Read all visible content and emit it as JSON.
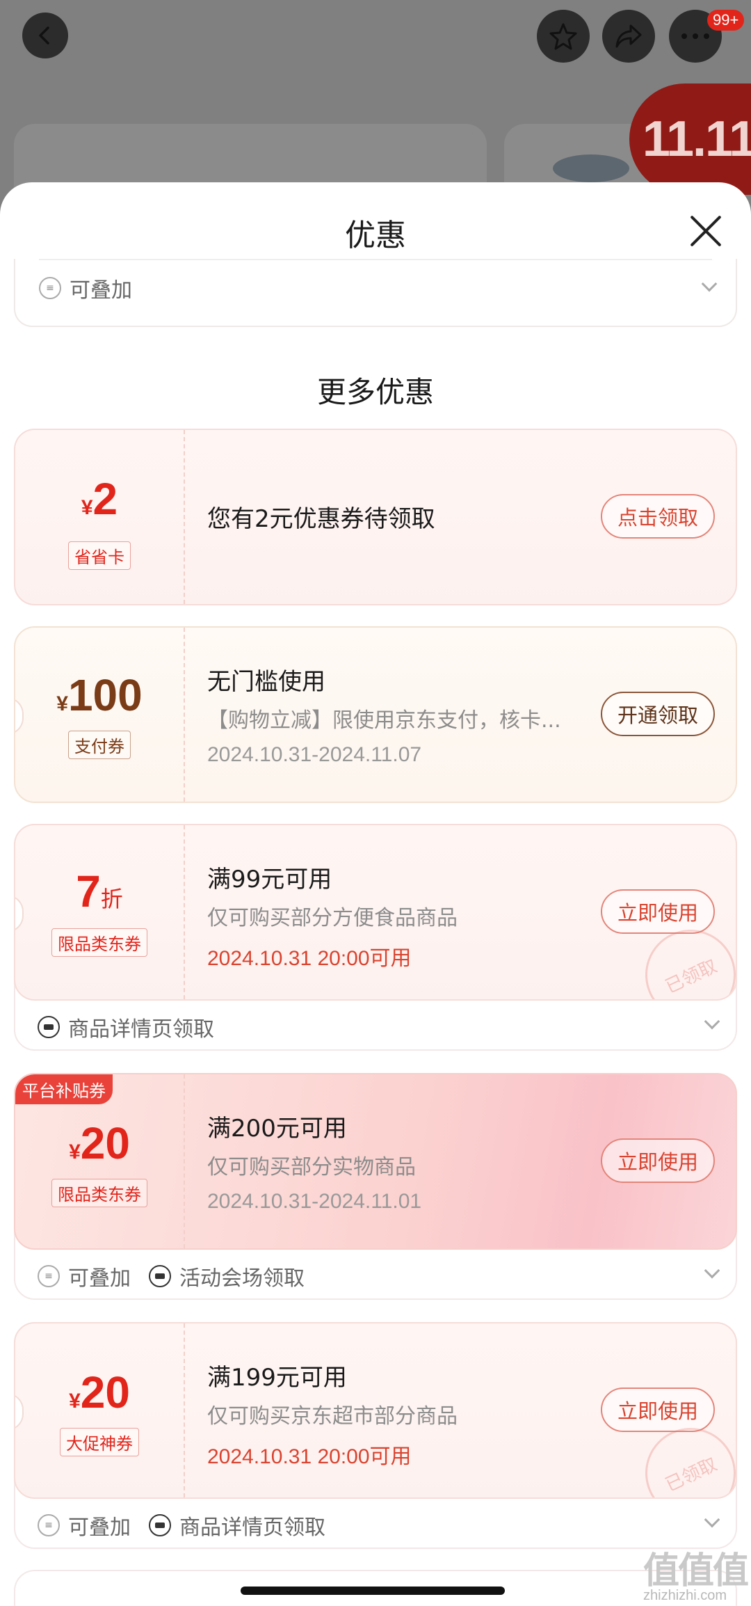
{
  "topbar": {
    "notification_badge": "99+",
    "promo_logo_text": "11.11",
    "icons": [
      "back-icon",
      "star-icon",
      "share-icon",
      "more-icon"
    ]
  },
  "sheet": {
    "title": "优惠",
    "prev_card_footer": "可叠加",
    "section_title": "更多优惠"
  },
  "coupons": [
    {
      "currency": "¥",
      "amount": "2",
      "tag": "省省卡",
      "title": "您有2元优惠券待领取",
      "button": "点击领取"
    },
    {
      "currency": "¥",
      "amount": "100",
      "tag": "支付券",
      "title": "无门槛使用",
      "desc": "【购物立减】限使用京东支付，核卡...",
      "date": "2024.10.31-2024.11.07",
      "button": "开通领取"
    },
    {
      "amount": "7",
      "unit": "折",
      "tag": "限品类东券",
      "title": "满99元可用",
      "desc": "仅可购买部分方便食品商品",
      "date": "2024.10.31 20:00可用",
      "button": "立即使用",
      "stamp": "已领取",
      "footer_source": "商品详情页领取"
    },
    {
      "ribbon": "平台补贴券",
      "currency": "¥",
      "amount": "20",
      "tag": "限品类东券",
      "title": "满200元可用",
      "desc": "仅可购买部分实物商品",
      "date": "2024.10.31-2024.11.01",
      "button": "立即使用",
      "footer_stack": "可叠加",
      "footer_source": "活动会场领取"
    },
    {
      "currency": "¥",
      "amount": "20",
      "tag": "大促神券",
      "title": "满199元可用",
      "desc": "仅可购买京东超市部分商品",
      "date": "2024.10.31 20:00可用",
      "button": "立即使用",
      "stamp": "已领取",
      "footer_stack": "可叠加",
      "footer_source": "商品详情页领取"
    }
  ],
  "watermark": {
    "logo": "值值值",
    "domain": "zhizhizhi.com"
  },
  "colors": {
    "accent_red": "#e1251b",
    "brown": "#7a3b17",
    "date_red": "#d9432f"
  }
}
